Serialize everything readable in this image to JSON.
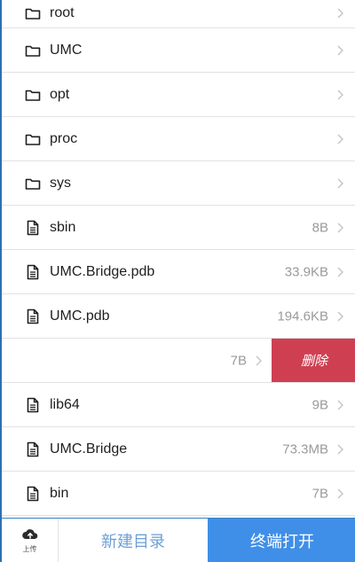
{
  "files": [
    {
      "name": "root",
      "type": "folder",
      "size": ""
    },
    {
      "name": "UMC",
      "type": "folder",
      "size": ""
    },
    {
      "name": "opt",
      "type": "folder",
      "size": ""
    },
    {
      "name": "proc",
      "type": "folder",
      "size": ""
    },
    {
      "name": "sys",
      "type": "folder",
      "size": ""
    },
    {
      "name": "sbin",
      "type": "file",
      "size": "8B"
    },
    {
      "name": "UMC.Bridge.pdb",
      "type": "file",
      "size": "33.9KB"
    },
    {
      "name": "UMC.pdb",
      "type": "file",
      "size": "194.6KB"
    },
    {
      "name": "",
      "type": "swiped",
      "size": "7B"
    },
    {
      "name": "lib64",
      "type": "file",
      "size": "9B"
    },
    {
      "name": "UMC.Bridge",
      "type": "file",
      "size": "73.3MB"
    },
    {
      "name": "bin",
      "type": "file",
      "size": "7B"
    }
  ],
  "delete_label": "删除",
  "toolbar": {
    "upload_label": "上传",
    "new_dir_label": "新建目录",
    "open_terminal_label": "终端打开"
  },
  "colors": {
    "delete_bg": "#cf3f52",
    "primary": "#3f8fe8",
    "link": "#6d9fd6",
    "frame": "#2f6fb3"
  },
  "icons": {
    "folder": "folder-icon",
    "file": "file-icon",
    "chevron": "chevron-right-icon",
    "upload": "cloud-upload-icon"
  }
}
